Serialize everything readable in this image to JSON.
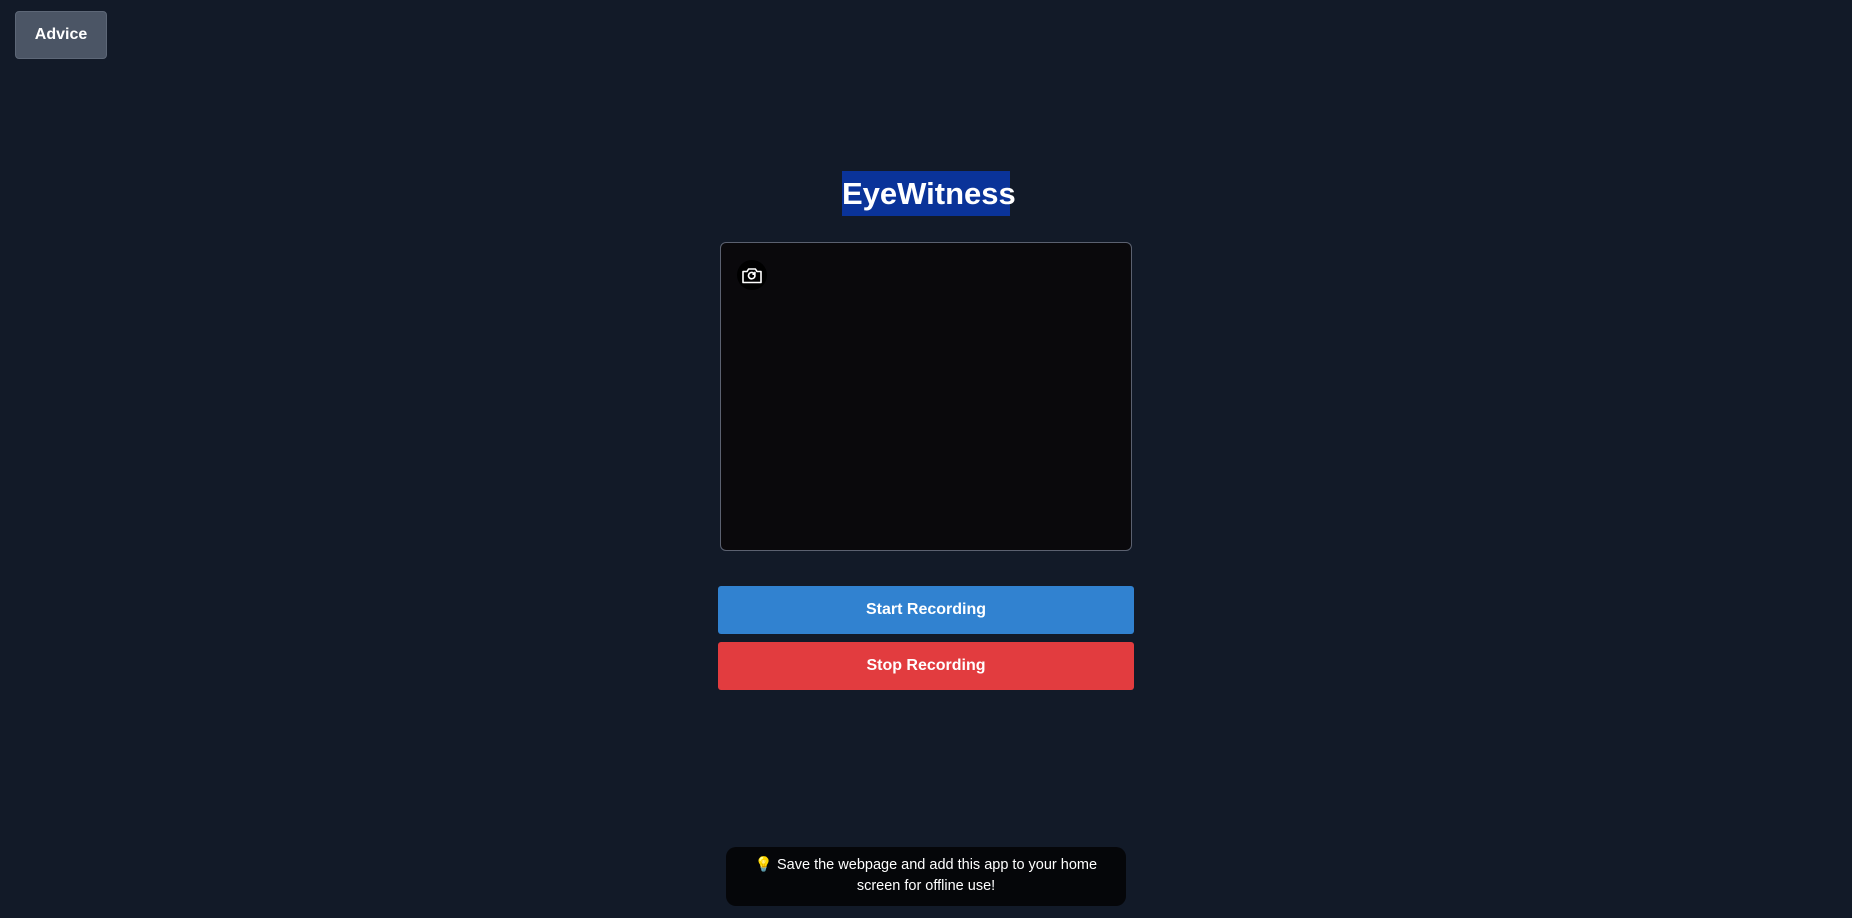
{
  "header": {
    "advice_label": "Advice"
  },
  "app": {
    "title": "EyeWitness"
  },
  "preview": {
    "switch_camera_icon": "camera-switch-icon"
  },
  "controls": {
    "start_label": "Start Recording",
    "stop_label": "Stop Recording"
  },
  "tip": {
    "emoji": "💡",
    "text": "Save the webpage and add this app to your home screen for offline use!"
  },
  "colors": {
    "background": "#121a28",
    "advice_button": "#4b5565",
    "title_highlight": "#0a3399",
    "start_button": "#3182d0",
    "stop_button": "#e23c3f",
    "tip_background": "#050609"
  }
}
